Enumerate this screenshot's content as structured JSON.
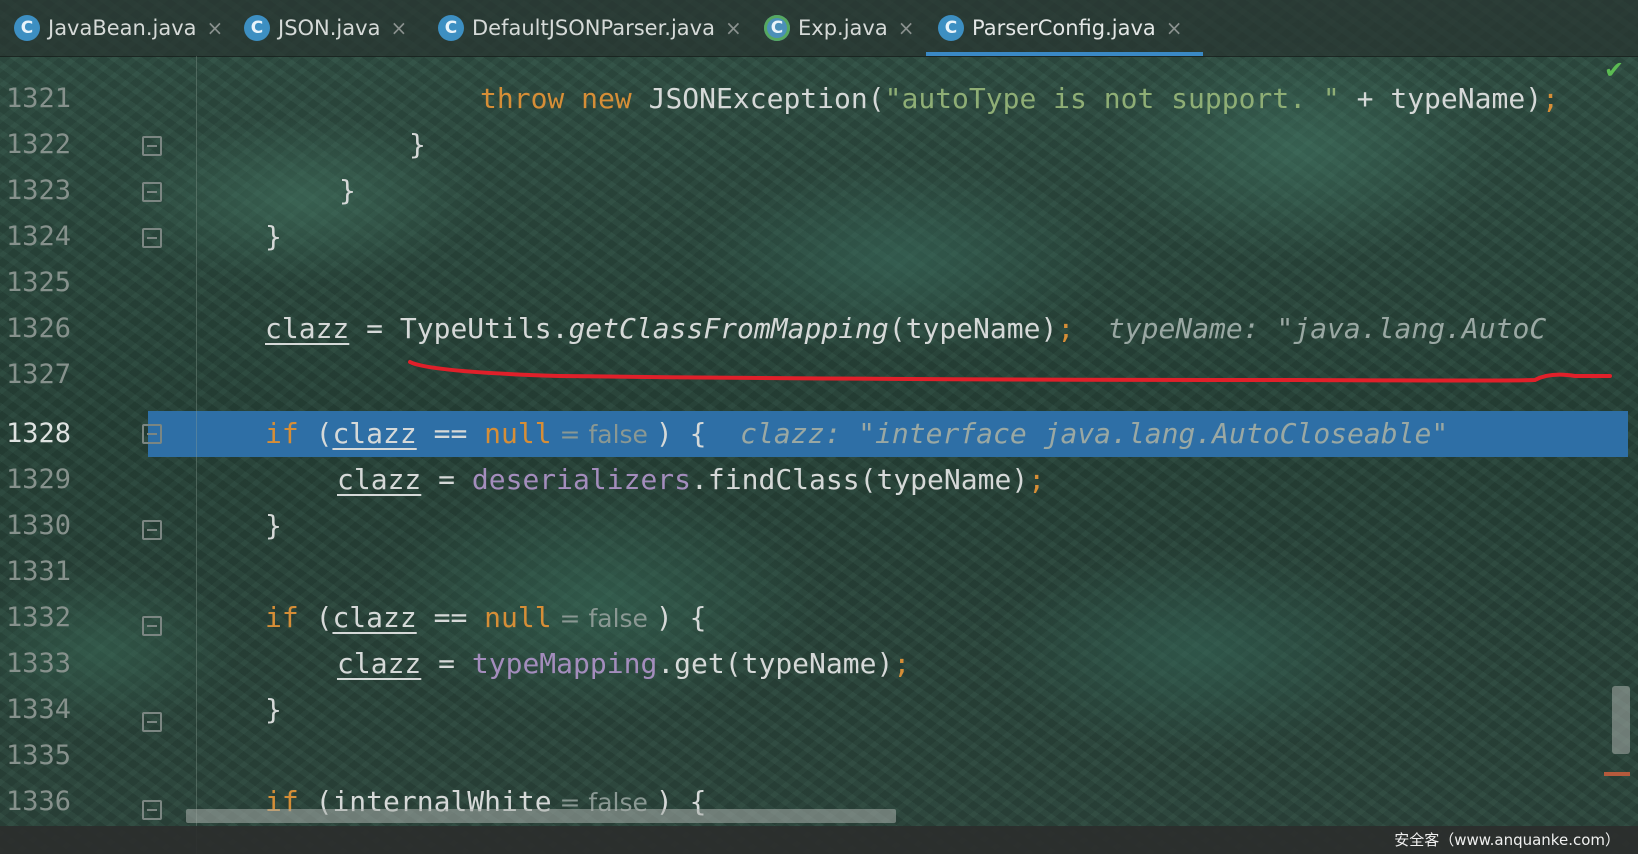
{
  "tabs": [
    {
      "label": "JavaBean.java",
      "icon": "class-icon",
      "active": false
    },
    {
      "label": "JSON.java",
      "icon": "class-icon",
      "active": false
    },
    {
      "label": "DefaultJSONParser.java",
      "icon": "class-icon",
      "active": false
    },
    {
      "label": "Exp.java",
      "icon": "runnable-class-icon",
      "active": false
    },
    {
      "label": "ParserConfig.java",
      "icon": "class-icon",
      "active": true
    }
  ],
  "line_numbers": [
    "1321",
    "1322",
    "1323",
    "1324",
    "1325",
    "1326",
    "1327",
    "1328",
    "1329",
    "1330",
    "1331",
    "1332",
    "1333",
    "1334",
    "1335",
    "1336"
  ],
  "current_line": "1328",
  "code": {
    "l1321": {
      "throw": "throw",
      "new": "new",
      "cls": "JSONException(",
      "str": "\"autoType is not support. \"",
      "rest": " + typeName)",
      "semi": ";"
    },
    "l1322": "}",
    "l1323": "}",
    "l1324": "}",
    "l1326": {
      "var": "clazz",
      "eq": " = ",
      "cls": "TypeUtils.",
      "method": "getClassFromMapping",
      "args": "(typeName)",
      "semi": ";",
      "hint": "typeName: \"java.lang.AutoC"
    },
    "l1328": {
      "if": "if",
      "open": " (",
      "var": "clazz",
      "op": " == ",
      "null": "null",
      "inlay": " = false ",
      "close": ") {",
      "hint": "clazz: \"interface java.lang.AutoCloseable\""
    },
    "l1329": {
      "var": "clazz",
      "eq": " = ",
      "field": "deserializers",
      "call": ".findClass(typeName)",
      "semi": ";"
    },
    "l1330": "}",
    "l1332": {
      "if": "if",
      "open": " (",
      "var": "clazz",
      "op": " == ",
      "null": "null",
      "inlay": " = false ",
      "close": ") {"
    },
    "l1333": {
      "var": "clazz",
      "eq": " = ",
      "field": "typeMapping",
      "call": ".get(typeName)",
      "semi": ";"
    },
    "l1334": "}",
    "l1336": {
      "if": "if",
      "open": " (",
      "var": "internalWhite",
      "inlay": " = false ",
      "close": ") {"
    }
  },
  "watermark": "安全客（www.anquanke.com）",
  "colors": {
    "keyword": "#d68e37",
    "string": "#8fae75",
    "field": "#a48dbd",
    "selection": "#2e6fa6",
    "annotation": "#e0202a"
  }
}
